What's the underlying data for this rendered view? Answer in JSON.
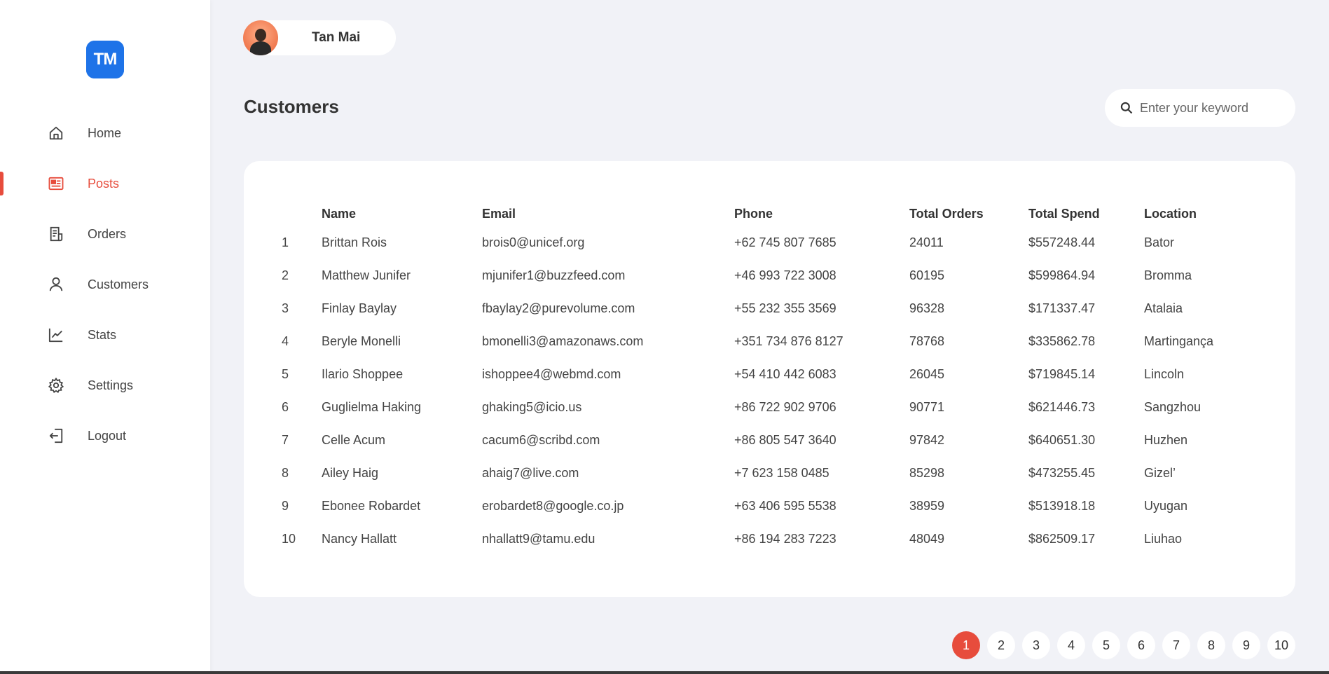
{
  "app": {
    "logo_text": "TM",
    "brand_color": "#1e73e8",
    "accent_color": "#e74c3c"
  },
  "sidebar": {
    "items": [
      {
        "label": "Home",
        "icon": "home-icon",
        "active": false
      },
      {
        "label": "Posts",
        "icon": "newspaper-icon",
        "active": true
      },
      {
        "label": "Orders",
        "icon": "receipt-icon",
        "active": false
      },
      {
        "label": "Customers",
        "icon": "user-icon",
        "active": false
      },
      {
        "label": "Stats",
        "icon": "chart-line-icon",
        "active": false
      },
      {
        "label": "Settings",
        "icon": "gear-icon",
        "active": false
      },
      {
        "label": "Logout",
        "icon": "logout-icon",
        "active": false
      }
    ]
  },
  "header": {
    "user_name": "Tan Mai"
  },
  "main": {
    "title": "Customers",
    "search": {
      "placeholder": "Enter your keyword",
      "value": ""
    },
    "table": {
      "columns": [
        "",
        "Name",
        "Email",
        "Phone",
        "Total Orders",
        "Total Spend",
        "Location"
      ],
      "rows": [
        [
          "1",
          "Brittan Rois",
          "brois0@unicef.org",
          "+62 745 807 7685",
          "24011",
          "$557248.44",
          "Bator"
        ],
        [
          "2",
          "Matthew Junifer",
          "mjunifer1@buzzfeed.com",
          "+46 993 722 3008",
          "60195",
          "$599864.94",
          "Bromma"
        ],
        [
          "3",
          "Finlay Baylay",
          "fbaylay2@purevolume.com",
          "+55 232 355 3569",
          "96328",
          "$171337.47",
          "Atalaia"
        ],
        [
          "4",
          "Beryle Monelli",
          "bmonelli3@amazonaws.com",
          "+351 734 876 8127",
          "78768",
          "$335862.78",
          "Martingança"
        ],
        [
          "5",
          "Ilario Shoppee",
          "ishoppee4@webmd.com",
          "+54 410 442 6083",
          "26045",
          "$719845.14",
          "Lincoln"
        ],
        [
          "6",
          "Guglielma Haking",
          "ghaking5@icio.us",
          "+86 722 902 9706",
          "90771",
          "$621446.73",
          "Sangzhou"
        ],
        [
          "7",
          "Celle Acum",
          "cacum6@scribd.com",
          "+86 805 547 3640",
          "97842",
          "$640651.30",
          "Huzhen"
        ],
        [
          "8",
          "Ailey Haig",
          "ahaig7@live.com",
          "+7 623 158 0485",
          "85298",
          "$473255.45",
          "Gizel’"
        ],
        [
          "9",
          "Ebonee Robardet",
          "erobardet8@google.co.jp",
          "+63 406 595 5538",
          "38959",
          "$513918.18",
          "Uyugan"
        ],
        [
          "10",
          "Nancy Hallatt",
          "nhallatt9@tamu.edu",
          "+86 194 283 7223",
          "48049",
          "$862509.17",
          "Liuhao"
        ]
      ]
    },
    "pagination": {
      "pages": [
        "1",
        "2",
        "3",
        "4",
        "5",
        "6",
        "7",
        "8",
        "9",
        "10"
      ],
      "current": "1"
    }
  }
}
